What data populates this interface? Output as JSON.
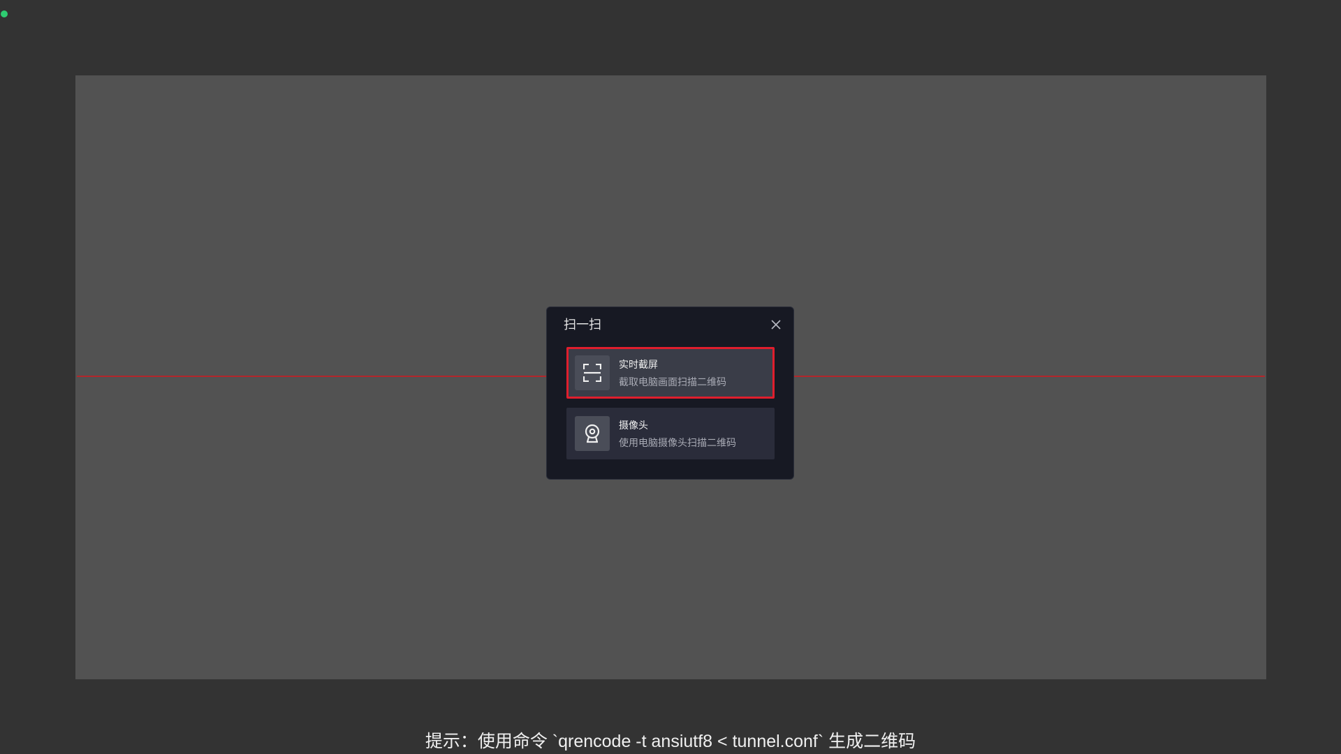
{
  "dialog": {
    "title": "扫一扫",
    "close_icon": "close-icon",
    "options": [
      {
        "title": "实时截屏",
        "description": "截取电脑画面扫描二维码",
        "icon": "screen-capture-icon",
        "selected": true
      },
      {
        "title": "摄像头",
        "description": "使用电脑摄像头扫描二维码",
        "icon": "webcam-icon",
        "selected": false
      }
    ]
  },
  "hint": "提示：使用命令 `qrencode -t ansiutf8 < tunnel.conf` 生成二维码",
  "colors": {
    "background": "#333333",
    "canvas": "#525252",
    "scan_line": "#b3262b",
    "dialog": "#171923",
    "selected_border": "#e01e2d",
    "status_dot": "#2ecc71"
  }
}
